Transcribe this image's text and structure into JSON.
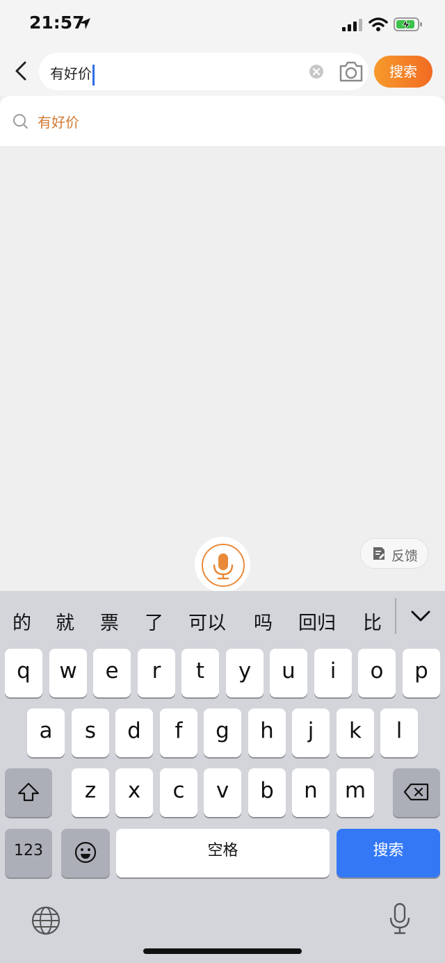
{
  "status_bar": {
    "time": "21:57"
  },
  "search": {
    "query": "有好价",
    "search_button_label": "搜索"
  },
  "suggestions": [
    {
      "text": "有好价"
    }
  ],
  "feedback": {
    "label": "反馈"
  },
  "keyboard": {
    "candidates": [
      "的",
      "就",
      "票",
      "了",
      "可以",
      "吗",
      "回归",
      "比"
    ],
    "row1": [
      "q",
      "w",
      "e",
      "r",
      "t",
      "y",
      "u",
      "i",
      "o",
      "p"
    ],
    "row2": [
      "a",
      "s",
      "d",
      "f",
      "g",
      "h",
      "j",
      "k",
      "l"
    ],
    "row3": [
      "z",
      "x",
      "c",
      "v",
      "b",
      "n",
      "m"
    ],
    "numbers_label": "123",
    "space_label": "空格",
    "return_label": "搜索"
  },
  "colors": {
    "accent_orange": "#f26b22",
    "suggestion_text": "#d07932",
    "keyboard_return_blue": "#3478f6"
  }
}
